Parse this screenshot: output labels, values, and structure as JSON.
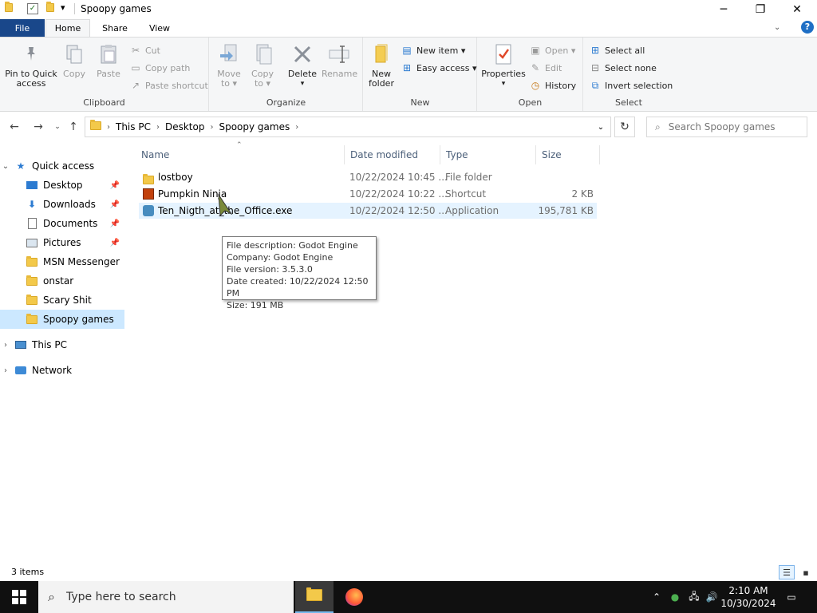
{
  "window": {
    "title": "Spoopy games",
    "qa_dropdown": "▾",
    "minimize": "─",
    "maximize": "❐",
    "close": "✕",
    "help": "?"
  },
  "tabs": {
    "file": "File",
    "home": "Home",
    "share": "Share",
    "view": "View"
  },
  "ribbon": {
    "clipboard": {
      "label": "Clipboard",
      "pin_line1": "Pin to Quick",
      "pin_line2": "access",
      "copy": "Copy",
      "paste": "Paste",
      "cut": "Cut",
      "copy_path": "Copy path",
      "paste_shortcut": "Paste shortcut"
    },
    "organize": {
      "label": "Organize",
      "move_to_1": "Move",
      "move_to_2": "to ▾",
      "copy_to_1": "Copy",
      "copy_to_2": "to ▾",
      "delete_1": "Delete",
      "delete_2": "▾",
      "rename": "Rename"
    },
    "new": {
      "label": "New",
      "new_folder_1": "New",
      "new_folder_2": "folder",
      "new_item": "New item ▾",
      "easy_access": "Easy access ▾"
    },
    "open": {
      "label": "Open",
      "properties": "Properties",
      "properties_dd": "▾",
      "open": "Open ▾",
      "edit": "Edit",
      "history": "History"
    },
    "select": {
      "label": "Select",
      "select_all": "Select all",
      "select_none": "Select none",
      "invert_selection": "Invert selection"
    }
  },
  "address": {
    "crumbs": [
      "This PC",
      "Desktop",
      "Spoopy games"
    ],
    "search_placeholder": "Search Spoopy games"
  },
  "nav": {
    "quick_access": "Quick access",
    "items": [
      {
        "label": "Desktop",
        "pinned": true
      },
      {
        "label": "Downloads",
        "pinned": true
      },
      {
        "label": "Documents",
        "pinned": true
      },
      {
        "label": "Pictures",
        "pinned": true
      },
      {
        "label": "MSN Messenger",
        "pinned": false
      },
      {
        "label": "onstar",
        "pinned": false
      },
      {
        "label": "Scary Shit",
        "pinned": false
      },
      {
        "label": "Spoopy games",
        "pinned": false,
        "selected": true
      }
    ],
    "this_pc": "This PC",
    "network": "Network"
  },
  "columns": {
    "name": "Name",
    "date": "Date modified",
    "type": "Type",
    "size": "Size"
  },
  "files": [
    {
      "name": "lostboy",
      "date": "10/22/2024 10:45 ...",
      "type": "File folder",
      "size": ""
    },
    {
      "name": "Pumpkin Ninja",
      "date": "10/22/2024 10:22 ...",
      "type": "Shortcut",
      "size": "2 KB"
    },
    {
      "name": "Ten_Nigth_at_the_Office.exe",
      "date": "10/22/2024 12:50 ...",
      "type": "Application",
      "size": "195,781 KB"
    }
  ],
  "tooltip": {
    "line1": "File description: Godot Engine",
    "line2": "Company: Godot Engine",
    "line3": "File version: 3.5.3.0",
    "line4": "Date created: 10/22/2024 12:50 PM",
    "line5": "Size: 191 MB"
  },
  "status": {
    "items_count": "3 items"
  },
  "taskbar": {
    "search_placeholder": "Type here to search",
    "time": "2:10 AM",
    "date": "10/30/2024"
  },
  "colors": {
    "file_tab": "#19478a",
    "selection": "#cce8ff",
    "hover": "#e5f3ff",
    "taskbar": "#101010"
  }
}
